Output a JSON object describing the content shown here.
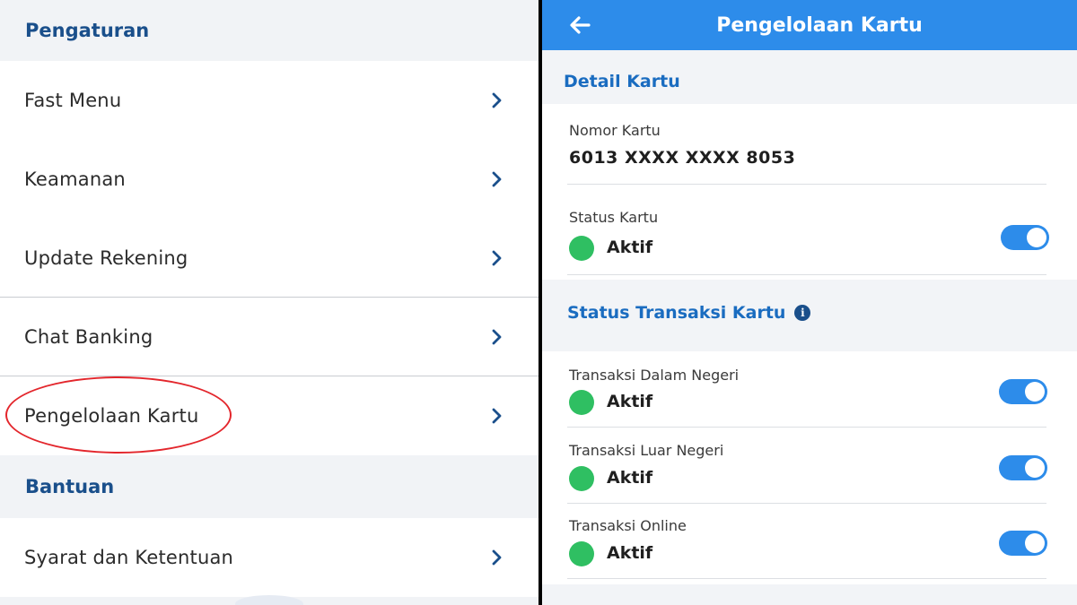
{
  "left": {
    "sections": {
      "pengaturan": "Pengaturan",
      "bantuan": "Bantuan"
    },
    "menu": [
      {
        "label": "Fast Menu",
        "icon": "chevron-right-icon"
      },
      {
        "label": "Keamanan",
        "icon": "chevron-right-icon"
      },
      {
        "label": "Update Rekening",
        "icon": "chevron-right-icon"
      },
      {
        "label": "Chat Banking",
        "icon": "chevron-right-icon"
      },
      {
        "label": "Pengelolaan Kartu",
        "icon": "chevron-right-icon"
      },
      {
        "label": "Syarat dan Ketentuan",
        "icon": "chevron-right-icon"
      }
    ],
    "highlight_color": "#e3262c"
  },
  "right": {
    "header": {
      "title": "Pengelolaan Kartu",
      "back_icon": "arrow-left-icon",
      "color": "#2d8cea"
    },
    "detail": {
      "heading": "Detail Kartu",
      "card_number_label": "Nomor Kartu",
      "card_number": "6013 XXXX XXXX 8053",
      "card_status_label": "Status Kartu",
      "card_status": "Aktif",
      "card_status_on": true
    },
    "transactions": {
      "heading": "Status Transaksi Kartu",
      "info_icon": "info-icon",
      "items": [
        {
          "label": "Transaksi Dalam Negeri",
          "status": "Aktif",
          "on": true
        },
        {
          "label": "Transaksi Luar Negeri",
          "status": "Aktif",
          "on": true
        },
        {
          "label": "Transaksi Online",
          "status": "Aktif",
          "on": true
        }
      ]
    },
    "status_color": "#2fbf62"
  }
}
